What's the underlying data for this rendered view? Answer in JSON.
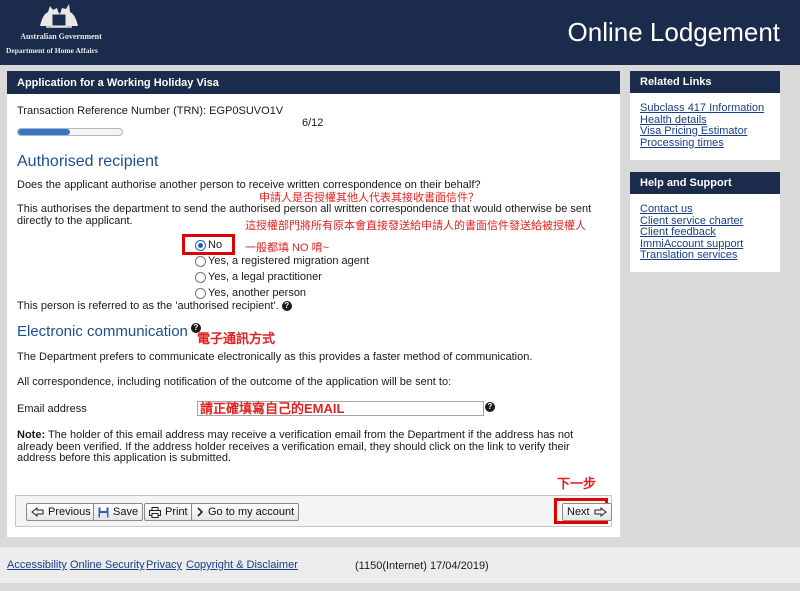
{
  "header": {
    "gov_name": "Australian Government",
    "dept_name": "Department of Home Affairs",
    "site_title": "Online Lodgement"
  },
  "form": {
    "title": "Application for a Working Holiday Visa",
    "trn_label": "Transaction Reference Number (TRN):",
    "trn_value": "EGP0SUVO1V",
    "step": "6/12",
    "progress_fraction": 0.5
  },
  "authorised": {
    "heading": "Authorised recipient",
    "question": "Does the applicant authorise another person to receive written correspondence on their behalf?",
    "explanation": "This authorises the department to send the authorised person all written correspondence that would otherwise be sent directly to the applicant.",
    "options": [
      {
        "label": "No",
        "checked": true
      },
      {
        "label": "Yes, a registered migration agent",
        "checked": false
      },
      {
        "label": "Yes, a legal practitioner",
        "checked": false
      },
      {
        "label": "Yes, another person",
        "checked": false
      }
    ],
    "referred_note": "This person is referred to as the 'authorised recipient'."
  },
  "electronic": {
    "heading": "Electronic communication",
    "prefers": "The Department prefers to communicate electronically as this provides a faster method of communication.",
    "all_corr": "All correspondence, including notification of the outcome of the application will be sent to:",
    "email_label": "Email address",
    "email_value": "請正確填寫自己的EMAIL",
    "note_label": "Note:",
    "note_text": " The holder of this email address may receive a verification email from the Department if the address has not already been verified. If the address holder receives a verification email, they should click on the link to verify their address before this application is submitted."
  },
  "annotations": {
    "ann_question": "申請人是否授權其他人代表其接收書面信件？",
    "ann_explanation": "這授權部門將所有原本會直接發送給申請人的書面信件發送給被授權人",
    "ann_no": "一般都填 NO 唷~",
    "ann_electronic": "電子通訊方式",
    "ann_next": "下一步"
  },
  "buttons": {
    "previous": "Previous",
    "save": "Save",
    "print": "Print",
    "account": "Go to my account",
    "next": "Next"
  },
  "related_links": {
    "title": "Related Links",
    "items": [
      "Subclass 417 Information",
      "Health details",
      "Visa Pricing Estimator",
      "Processing times"
    ]
  },
  "help_support": {
    "title": "Help and Support",
    "items": [
      "Contact us",
      "Client service charter",
      "Client feedback",
      "ImmiAccount support",
      "Translation services"
    ]
  },
  "footer": {
    "links": [
      "Accessibility",
      "Online Security",
      "Privacy",
      "Copyright & Disclaimer"
    ],
    "version": "(1150(Internet) 17/04/2019)"
  },
  "colors": {
    "navy": "#1b2b4b",
    "heading_blue": "#1c4f93",
    "annotation_red": "#e22222",
    "link_blue": "#1a3e8a"
  }
}
